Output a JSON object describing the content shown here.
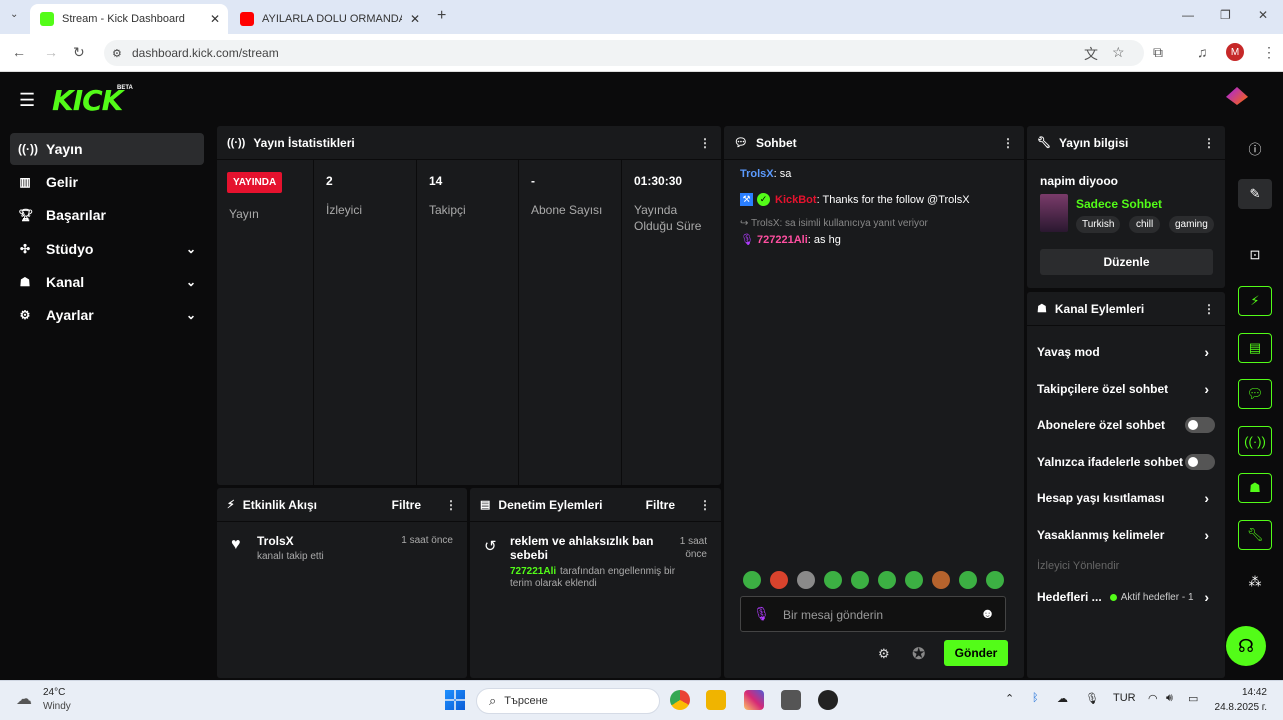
{
  "browser": {
    "tabs": [
      {
        "title": "Stream - Kick Dashboard",
        "active": true,
        "favicon": "kick-icon",
        "favicon_color": "#53fc18"
      },
      {
        "title": "AYILARLA DOLU ORMANDA HA...",
        "active": false,
        "favicon": "youtube-icon",
        "favicon_color": "#ff0000"
      }
    ],
    "url": "dashboard.kick.com/stream",
    "profile_initial": "M"
  },
  "app": {
    "logo": "KICK",
    "logo_badge": "BETA",
    "accent": "#53fc18",
    "sidebar": [
      {
        "label": "Yayın",
        "icon": "broadcast-icon",
        "selected": true,
        "expandable": false
      },
      {
        "label": "Gelir",
        "icon": "chart-icon",
        "selected": false,
        "expandable": false
      },
      {
        "label": "Başarılar",
        "icon": "trophy-icon",
        "selected": false,
        "expandable": false
      },
      {
        "label": "Stüdyo",
        "icon": "studio-icon",
        "selected": false,
        "expandable": true
      },
      {
        "label": "Kanal",
        "icon": "channel-icon",
        "selected": false,
        "expandable": true
      },
      {
        "label": "Ayarlar",
        "icon": "gear-icon",
        "selected": false,
        "expandable": true
      }
    ],
    "stats": {
      "title": "Yayın İstatistikleri",
      "live_badge": "YAYINDA",
      "columns": [
        {
          "value": "",
          "label": "Yayın"
        },
        {
          "value": "2",
          "label": "İzleyici"
        },
        {
          "value": "14",
          "label": "Takipçi"
        },
        {
          "value": "-",
          "label": "Abone Sayısı"
        },
        {
          "value": "01:30:30",
          "label": "Yayında Olduğu Süre"
        }
      ]
    },
    "activity": {
      "title": "Etkinlik Akışı",
      "filter": "Filtre",
      "items": [
        {
          "user": "TrolsX",
          "text": "kanalı takip etti",
          "time": "1 saat önce"
        }
      ]
    },
    "moderation": {
      "title": "Denetim Eylemleri",
      "filter": "Filtre",
      "items": [
        {
          "title": "reklem ve ahlaksızlık ban sebebi",
          "user": "727221Ali",
          "text": "tarafından engellenmiş bir terim olarak eklendi",
          "time": "1 saat önce"
        }
      ]
    },
    "chat": {
      "title": "Sohbet",
      "messages": [
        {
          "user": "TrolsX",
          "text": ": sa",
          "user_color": "#5b9bff"
        },
        {
          "user": "KickBot",
          "text": ": Thanks for the follow @TrolsX",
          "user_color": "#e5122e"
        }
      ],
      "reply_context": "TrolsX: sa isimli kullanıcıya yanıt veriyor",
      "reply": {
        "user": "727221Ali",
        "text": ": as hg",
        "user_color": "#ff4fa1"
      },
      "input_placeholder": "Bir mesaj gönderin",
      "send_label": "Gönder"
    },
    "stream_info": {
      "title": "Yayın bilgisi",
      "stream_title": "napim diyooo",
      "category": "Sadece Sohbet",
      "tags": [
        "Turkish",
        "chill",
        "gaming"
      ],
      "edit_label": "Düzenle"
    },
    "channel_actions": {
      "title": "Kanal Eylemleri",
      "rows": [
        {
          "label": "Yavaş mod",
          "type": "arrow"
        },
        {
          "label": "Takipçilere özel sohbet",
          "type": "arrow"
        },
        {
          "label": "Abonelere özel sohbet",
          "type": "toggle",
          "on": false
        },
        {
          "label": "Yalnızca ifadelerle sohbet",
          "type": "toggle",
          "on": false
        },
        {
          "label": "Hesap yaşı kısıtlaması",
          "type": "arrow"
        },
        {
          "label": "Yasaklanmış kelimeler",
          "type": "arrow"
        }
      ],
      "section_label": "İzleyici Yönlendir",
      "goals_label": "Hedefleri ...",
      "goals_status": "Aktif hedefler - 1"
    }
  },
  "taskbar": {
    "weather_temp": "24°C",
    "weather_text": "Windy",
    "search_placeholder": "Търсене",
    "language": "TUR",
    "time": "14:42",
    "date": "24.8.2025 г."
  }
}
